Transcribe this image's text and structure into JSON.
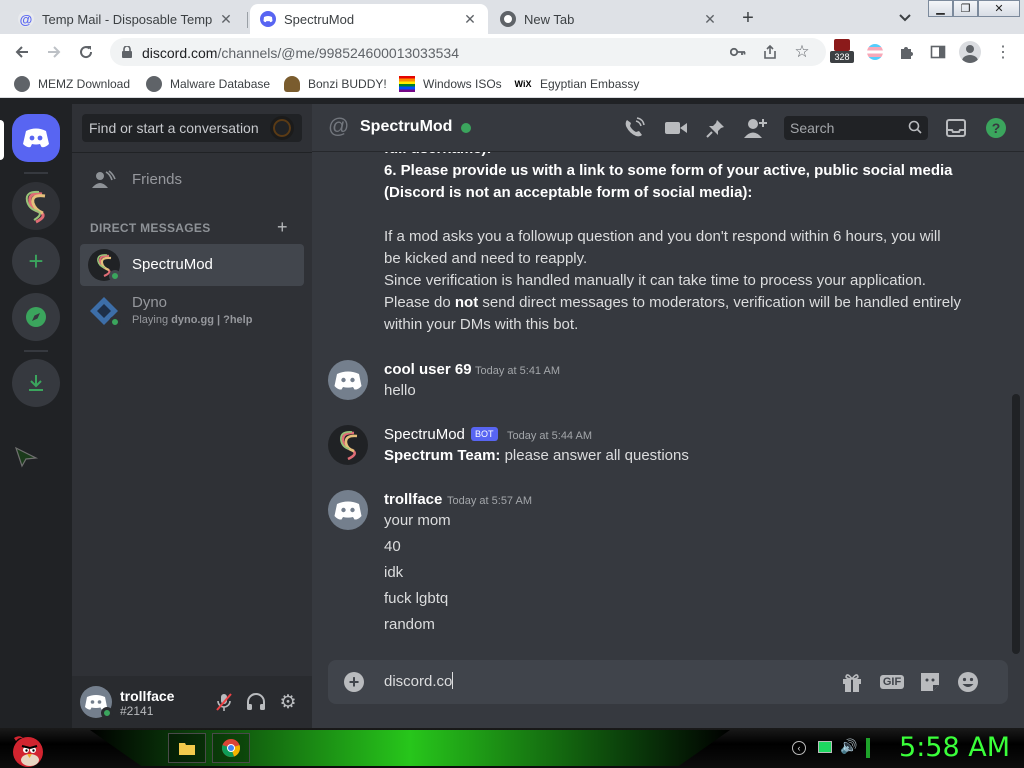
{
  "browser": {
    "tabs": [
      {
        "title": "Temp Mail - Disposable Temporary",
        "active": false
      },
      {
        "title": "SpectruMod",
        "active": true
      },
      {
        "title": "New Tab",
        "active": false
      }
    ],
    "url": {
      "host": "discord.com",
      "path": "/channels/@me/998524600013033534"
    },
    "extensions_badge": "328",
    "bookmarks": [
      "MEMZ Download",
      "Malware Database",
      "Bonzi BUDDY!",
      "Windows ISOs",
      "Egyptian Embassy"
    ]
  },
  "discord": {
    "search_placeholder": "Find or start a conversation",
    "friends_label": "Friends",
    "direct_messages_label": "DIRECT MESSAGES",
    "dms": [
      {
        "name": "SpectruMod",
        "activity": ""
      },
      {
        "name": "Dyno",
        "activity_prefix": "Playing ",
        "activity_game": "dyno.gg | ?help"
      }
    ],
    "user": {
      "name": "trollface",
      "tag": "#2141"
    },
    "channel_name": "SpectruMod",
    "header_search": "Search",
    "messages": {
      "intro_cut": "full username):",
      "intro_q6": "6. Please provide us with a link to some form of your active, public social media",
      "intro_q6b": "(Discord is not an acceptable form of social media):",
      "intro_p1": "If a mod asks you a followup question and you don't respond within 6 hours, you will",
      "intro_p2": "be kicked and need to reapply.",
      "intro_p3": "Since verification is handled manually it can take time to process your application.",
      "intro_p4a": "Please do ",
      "intro_p4b": "not",
      "intro_p4c": " send direct messages to moderators, verification will be handled entirely",
      "intro_p5": "within your DMs with this bot.",
      "m1_author": "cool user 69",
      "m1_time": "Today at 5:41 AM",
      "m1_text": "hello",
      "m2_author": "SpectruMod",
      "m2_badge": "BOT",
      "m2_time": "Today at 5:44 AM",
      "m2_bold": "Spectrum Team:",
      "m2_text": " please answer all questions",
      "m3_author": "trollface",
      "m3_time": "Today at 5:57 AM",
      "m3_lines": [
        "your mom",
        "40",
        "idk",
        "fuck lgbtq",
        "random"
      ]
    },
    "composer_text": "discord.co",
    "colors": {
      "blurple": "#5865f2",
      "online": "#3ba55d",
      "green": "#3ba55d"
    }
  },
  "taskbar": {
    "time": "5:58 AM"
  }
}
